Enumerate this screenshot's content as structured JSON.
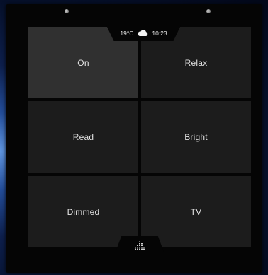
{
  "status": {
    "temperature": "19°C",
    "weather_icon": "cloud-icon",
    "time": "10:23"
  },
  "scenes": [
    {
      "label": "On",
      "active": true
    },
    {
      "label": "Relax",
      "active": false
    },
    {
      "label": "Read",
      "active": false
    },
    {
      "label": "Bright",
      "active": false
    },
    {
      "label": "Dimmed",
      "active": false
    },
    {
      "label": "TV",
      "active": false
    }
  ],
  "bottom_tab": {
    "icon": "equalizer-icon"
  },
  "colors": {
    "tile": "#1c1c1c",
    "tile_active": "#303030",
    "bezel": "#050505",
    "text": "#e2e2e2"
  }
}
